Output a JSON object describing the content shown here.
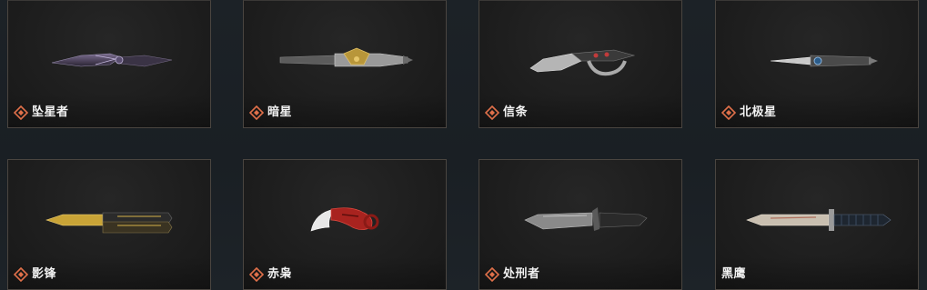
{
  "colors": {
    "page_background": "#1b2126",
    "card_background": "#1e1e1e",
    "card_border": "#4a4540",
    "rarity_accent": "#e0704a",
    "text": "#f2f2f2"
  },
  "icons": {
    "rarity": "rarity-diamond-icon"
  },
  "knives": [
    {
      "name": "坠星者",
      "weapon_icon": "falling-star-knife-icon"
    },
    {
      "name": "暗星",
      "weapon_icon": "dark-star-knife-icon"
    },
    {
      "name": "信条",
      "weapon_icon": "creed-knife-icon"
    },
    {
      "name": "北极星",
      "weapon_icon": "polaris-knife-icon"
    },
    {
      "name": "影锋",
      "weapon_icon": "shadow-butterfly-knife-icon"
    },
    {
      "name": "赤枭",
      "weapon_icon": "red-karambit-icon"
    },
    {
      "name": "处刑者",
      "weapon_icon": "executioner-knife-icon"
    },
    {
      "name": "黑鹰",
      "weapon_icon": "black-hawk-bayonet-icon"
    }
  ]
}
